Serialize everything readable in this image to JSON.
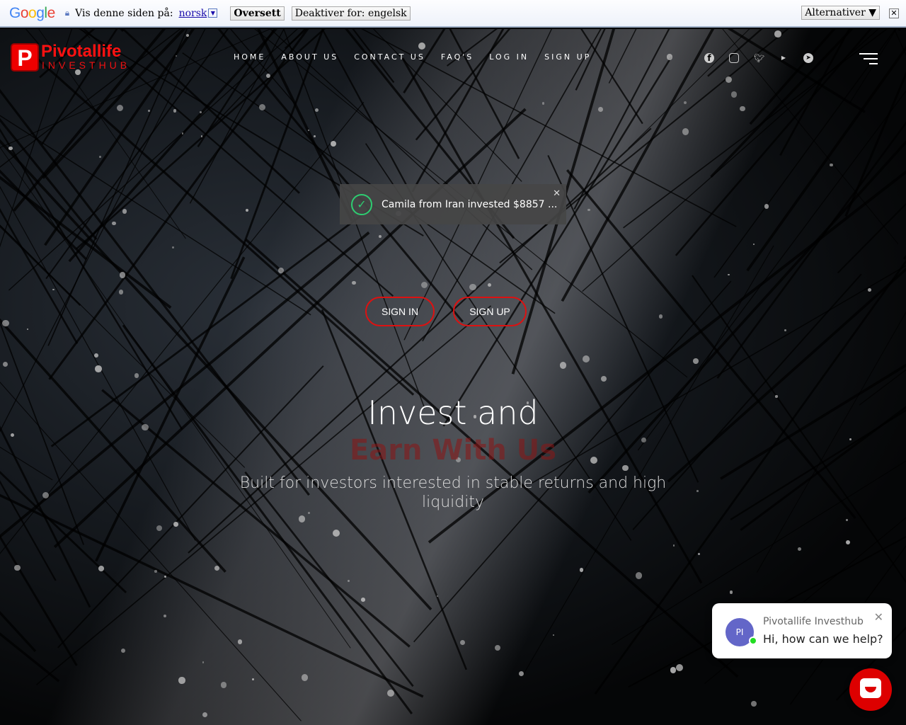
{
  "translate_bar": {
    "logo": "Google",
    "prompt": "Vis denne siden på:",
    "language": "norsk",
    "translate_button": "Oversett",
    "disable_button": "Deaktiver for: engelsk",
    "options_button": "Alternativer ▼",
    "close": "✕"
  },
  "site": {
    "logo_letter": "P",
    "logo_title": "Pivotallife",
    "logo_subtitle": "INVESTHUB"
  },
  "nav": {
    "items": [
      "HOME",
      "ABOUT US",
      "CONTACT US",
      "FAQ'S",
      "LOG IN",
      "SIGN UP"
    ]
  },
  "social": {
    "icons": [
      "facebook-icon",
      "instagram-icon",
      "twitter-icon",
      "youtube-icon",
      "telegram-icon"
    ]
  },
  "toast": {
    "message": "Camila from Iran invested $8857 ...",
    "close": "✕"
  },
  "hero": {
    "sign_in": "SIGN IN",
    "sign_up": "SIGN UP",
    "title": "Invest and",
    "title_accent": "Earn With Us",
    "subtitle": "Built for investors interested in stable returns and high liquidity"
  },
  "chat": {
    "avatar_initials": "PI",
    "agent_name": "Pivotallife Investhub",
    "greeting": "Hi, how can we help?",
    "close": "✕"
  }
}
